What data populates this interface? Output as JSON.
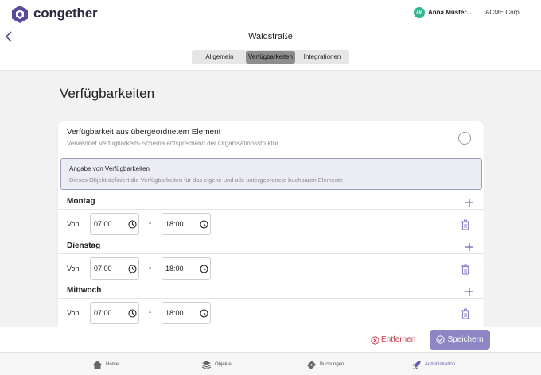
{
  "app": {
    "brand": "congether",
    "brand_color": "#5a4b9a",
    "accent": "#8d86c4"
  },
  "user": {
    "initials": "AM",
    "name": "Anna Muster...",
    "org": "ACME Corp."
  },
  "header": {
    "title": "Waldstraße",
    "tabs": [
      {
        "label": "Allgemein",
        "active": false
      },
      {
        "label": "Verfügbarkeiten",
        "active": true
      },
      {
        "label": "Integrationen",
        "active": false
      }
    ]
  },
  "main": {
    "section_title": "Verfügbarkeiten",
    "option_inherit": {
      "title": "Verfügbarkeit aus übergeordnetem Element",
      "subtitle": "Verwendet Verfügbarkeits-Schema entsprechend der Organisationsstruktur",
      "selected": false
    },
    "option_specify": {
      "title": "Angabe von Verfügbarkeiten",
      "subtitle": "Dieses Objekt definiert die Verfügbarkeiten für das eigene und alle untergeordnete buchbaren Elemente.",
      "selected": true
    },
    "from_label": "Von",
    "separator": "-",
    "days": [
      {
        "name": "Montag",
        "from": "07:00",
        "to": "18:00"
      },
      {
        "name": "Dienstag",
        "from": "07:00",
        "to": "18:00"
      },
      {
        "name": "Mittwoch",
        "from": "07:00",
        "to": "18:00"
      }
    ]
  },
  "actions": {
    "remove_label": "Entfernen",
    "save_label": "Speichern"
  },
  "bottom_nav": [
    {
      "label": "Home",
      "icon": "home-icon",
      "active": false
    },
    {
      "label": "Objekte",
      "icon": "layers-icon",
      "active": false
    },
    {
      "label": "Buchungen",
      "icon": "ticket-icon",
      "active": false
    },
    {
      "label": "Administration",
      "icon": "rocket-icon",
      "active": true
    }
  ]
}
